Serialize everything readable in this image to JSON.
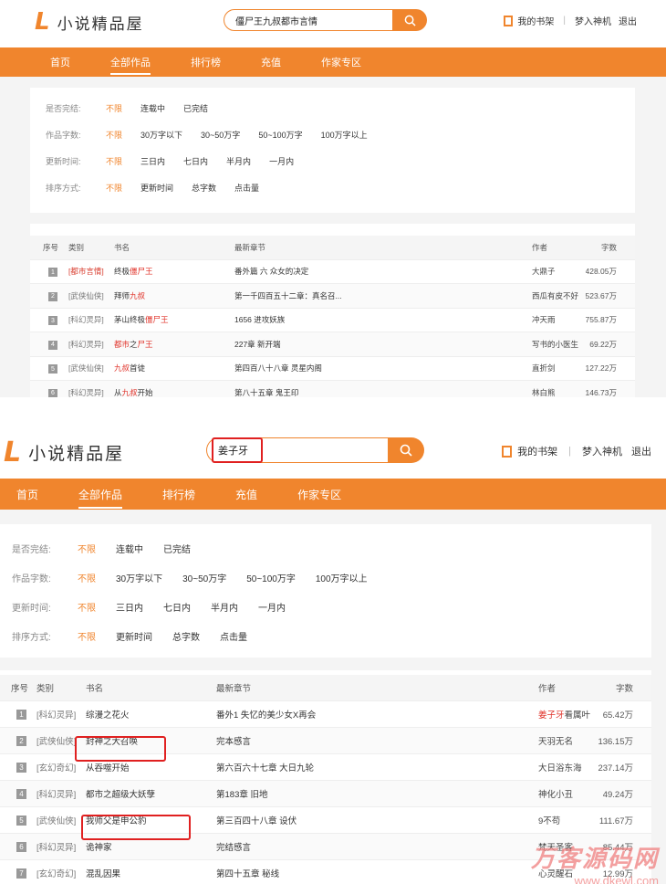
{
  "brand": {
    "logo_mark": "L",
    "name": "小说精品屋",
    "accent": "#f0852d"
  },
  "user": {
    "bookshelf": "我的书架",
    "username": "梦入神机",
    "logout": "退出"
  },
  "nav": [
    "首页",
    "全部作品",
    "排行榜",
    "充值",
    "作家专区"
  ],
  "filters": [
    {
      "label": "是否完结:",
      "options": [
        "不限",
        "连载中",
        "已完结"
      ]
    },
    {
      "label": "作品字数:",
      "options": [
        "不限",
        "30万字以下",
        "30~50万字",
        "50~100万字",
        "100万字以上"
      ]
    },
    {
      "label": "更新时间:",
      "options": [
        "不限",
        "三日内",
        "七日内",
        "半月内",
        "一月内"
      ]
    },
    {
      "label": "排序方式:",
      "options": [
        "不限",
        "更新时间",
        "总字数",
        "点击量"
      ]
    }
  ],
  "columns": [
    "序号",
    "类别",
    "书名",
    "最新章节",
    "作者",
    "字数"
  ],
  "screen1": {
    "search_value": "僵尸王九叔都市言情",
    "rows": [
      {
        "n": "1",
        "cat": "[都市言情]",
        "cat_red": true,
        "title": [
          [
            "终极",
            false
          ],
          [
            "僵尸王",
            true
          ]
        ],
        "chapter": "番外篇 六 众女的决定",
        "author": "大鼎子",
        "words": "428.05万"
      },
      {
        "n": "2",
        "cat": "[武侠仙侠]",
        "cat_red": false,
        "title": [
          [
            "拜师",
            false
          ],
          [
            "九叔",
            true
          ]
        ],
        "chapter": "第一千四百五十二章：真名召...",
        "author": "西瓜有皮不好",
        "words": "523.67万"
      },
      {
        "n": "3",
        "cat": "[科幻灵异]",
        "cat_red": false,
        "title": [
          [
            "茅山终极",
            false
          ],
          [
            "僵尸王",
            true
          ]
        ],
        "chapter": "1656 进攻妖族",
        "author": "冲天雨",
        "words": "755.87万"
      },
      {
        "n": "4",
        "cat": "[科幻灵异]",
        "cat_red": false,
        "title": [
          [
            "都市",
            true
          ],
          [
            "之",
            false
          ],
          [
            "尸王",
            true
          ]
        ],
        "chapter": "227章 新开端",
        "author": "写书的小医生",
        "words": "69.22万"
      },
      {
        "n": "5",
        "cat": "[武侠仙侠]",
        "cat_red": false,
        "title": [
          [
            "九叔",
            true
          ],
          [
            "首徒",
            false
          ]
        ],
        "chapter": "第四百八十八章 灵星内阁",
        "author": "直折剑",
        "words": "127.22万"
      },
      {
        "n": "6",
        "cat": "[科幻灵异]",
        "cat_red": false,
        "title": [
          [
            "从",
            false
          ],
          [
            "九叔",
            true
          ],
          [
            "开始",
            false
          ]
        ],
        "chapter": "第八十五章 鬼王印",
        "author": "林白熊",
        "words": "146.73万"
      }
    ]
  },
  "screen2": {
    "search_value": "姜子牙",
    "rows": [
      {
        "n": "1",
        "cat": "[科幻灵异]",
        "title": "综漫之花火",
        "chapter": "番外1 失忆的美少女X再会",
        "author": [
          [
            "姜子牙",
            true
          ],
          [
            "看属叶",
            false
          ]
        ],
        "words": "65.42万"
      },
      {
        "n": "2",
        "cat": "[武侠仙侠]",
        "title": "封神之大召唤",
        "chapter": "完本感言",
        "author": [
          [
            "天羽无名",
            false
          ]
        ],
        "words": "136.15万"
      },
      {
        "n": "3",
        "cat": "[玄幻奇幻]",
        "title": "从吞噬开始",
        "chapter": "第六百六十七章 大日九轮",
        "author": [
          [
            "大日浴东海",
            false
          ]
        ],
        "words": "237.14万"
      },
      {
        "n": "4",
        "cat": "[科幻灵异]",
        "title": "都市之超级大妖孽",
        "chapter": "第183章 旧地",
        "author": [
          [
            "神化小丑",
            false
          ]
        ],
        "words": "49.24万"
      },
      {
        "n": "5",
        "cat": "[武侠仙侠]",
        "title": "我师父是申公豹",
        "chapter": "第三百四十八章 设伏",
        "author": [
          [
            "9不苟",
            false
          ]
        ],
        "words": "111.67万"
      },
      {
        "n": "6",
        "cat": "[科幻灵异]",
        "title": "诡神家",
        "chapter": "完结感言",
        "author": [
          [
            "梵天圣客",
            false
          ]
        ],
        "words": "85.44万"
      },
      {
        "n": "7",
        "cat": "[玄幻奇幻]",
        "title": "混乱因果",
        "chapter": "第四十五章 秘线",
        "author": [
          [
            "心灵醒石",
            false
          ]
        ],
        "words": "12.99万"
      }
    ]
  },
  "watermark": {
    "line1": "万客源码网",
    "line2": "www.dkewl.com"
  }
}
